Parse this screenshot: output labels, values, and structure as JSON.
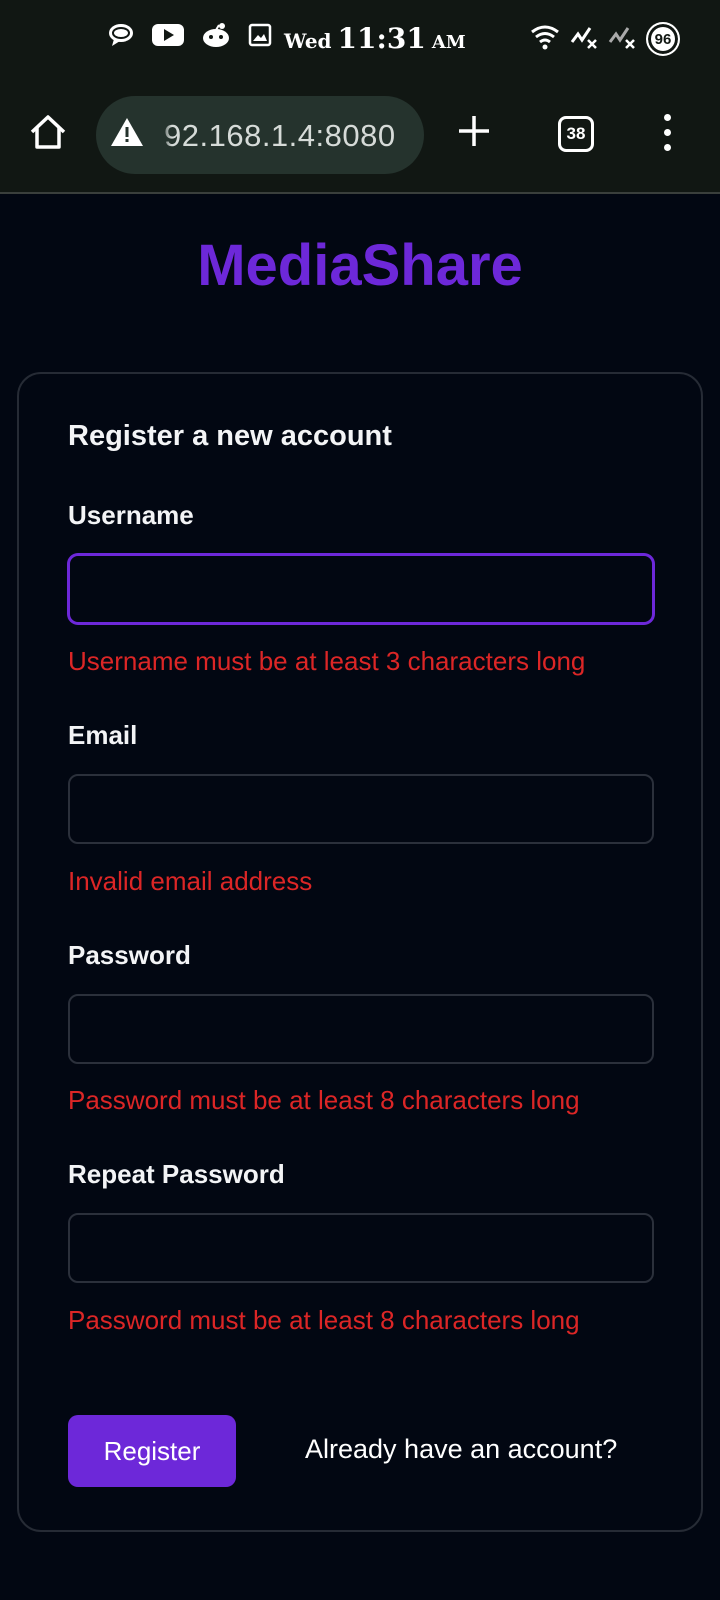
{
  "status_bar": {
    "icons": [
      "chat-bubble-icon",
      "youtube-icon",
      "reddit-icon",
      "gallery-icon"
    ],
    "day": "Wed",
    "time": "11:31",
    "ampm": "AM",
    "right_icons": [
      "wifi-icon",
      "signal-x-icon",
      "signal-x-icon"
    ],
    "battery": "96"
  },
  "browser": {
    "url": "92.168.1.4:8080",
    "tab_count": "38",
    "icons": {
      "home": "home-icon",
      "warning": "warning-icon",
      "new_tab": "plus-icon",
      "menu": "more-vert-icon"
    }
  },
  "app": {
    "brand": "MediaShare",
    "brand_color": "#6d28d9"
  },
  "form": {
    "title": "Register a new account",
    "fields": [
      {
        "label": "Username",
        "value": "",
        "error": "Username must be at least 3 characters long",
        "focused": true
      },
      {
        "label": "Email",
        "value": "",
        "error": "Invalid email address"
      },
      {
        "label": "Password",
        "value": "",
        "error": "Password must be at least 8 characters long"
      },
      {
        "label": "Repeat Password",
        "value": "",
        "error": "Password must be at least 8 characters long"
      }
    ],
    "submit_label": "Register",
    "login_link": "Already have an account?"
  },
  "colors": {
    "accent": "#6d28d9",
    "error": "#dc2626",
    "background": "#020712"
  }
}
